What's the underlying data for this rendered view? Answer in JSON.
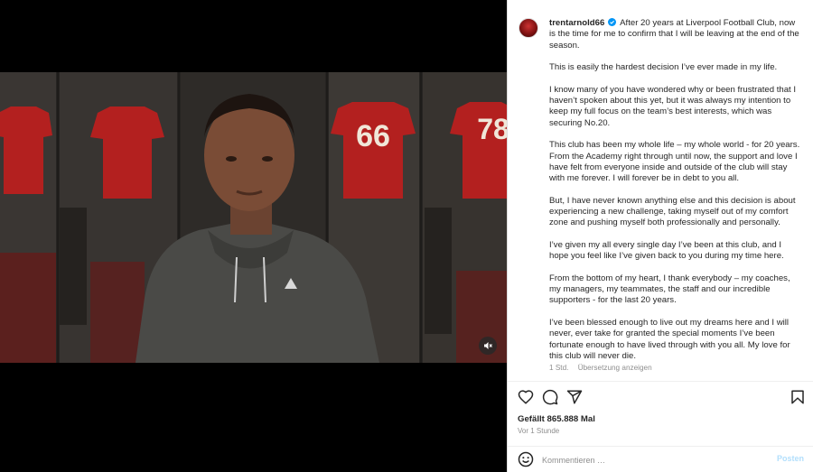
{
  "post": {
    "username": "trentarnold66",
    "verified_icon": "verified-badge-icon",
    "caption_first_line": "After 20 years at Liverpool Football Club, now is the time for me to confirm that I will be leaving at the end of the season.",
    "paragraphs": [
      "This is easily the hardest decision I’ve ever made in my life.",
      "I know many of you have wondered why or been frustrated that I haven’t spoken about this yet, but it was always my intention to keep my full focus on the team’s best interests, which was securing No.20.",
      "This club has been my whole life – my whole world - for 20 years. From the Academy right through until now, the support and love I have felt from everyone inside and outside of the club will stay with me forever. I will forever be in debt to you all.",
      "But, I have never known anything else and this decision is about experiencing a new challenge, taking myself out of my comfort zone and pushing myself both professionally and personally.",
      "I’ve given my all every single day I’ve been at this club, and I hope you feel like I’ve given back to you during my time here.",
      "From the bottom of my heart, I thank everybody – my coaches, my managers, my teammates, the staff and our incredible supporters - for the last 20 years.",
      "I’ve been blessed enough to live out my dreams here and I will never, ever take for granted the special moments I’ve been fortunate enough to have lived through with you all. My love for this club will never die."
    ],
    "meta_time": "1 Std.",
    "translate_label": "Übersetzung anzeigen",
    "likes": "Gefällt 865.888 Mal",
    "timestamp": "Vor 1 Stunde"
  },
  "video": {
    "jersey_numbers": [
      "66",
      "78"
    ],
    "mute_icon": "speaker-muted-icon"
  },
  "comment": {
    "placeholder": "Kommentieren …",
    "post_label": "Posten"
  },
  "colors": {
    "verified": "#0095f6",
    "jersey_red": "#b3201f",
    "post_button": "#b2dffc"
  }
}
